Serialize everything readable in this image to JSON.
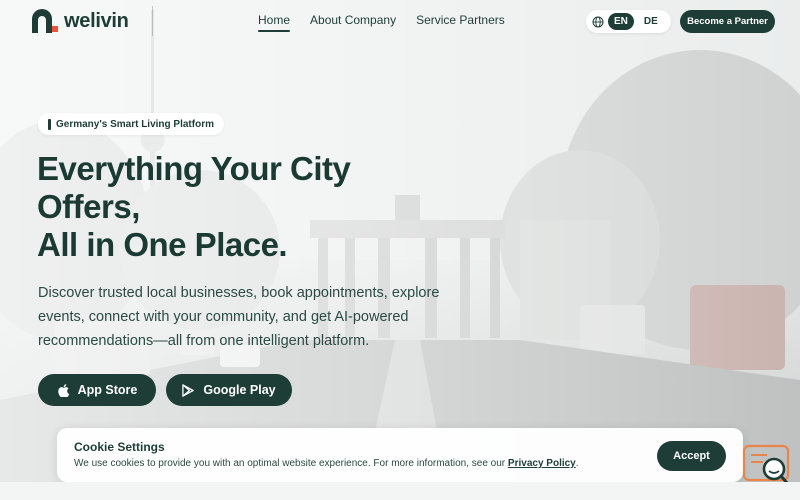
{
  "header": {
    "logo_text": "welivin",
    "nav": [
      {
        "label": "Home",
        "active": true
      },
      {
        "label": "About Company",
        "active": false
      },
      {
        "label": "Service Partners",
        "active": false
      }
    ],
    "languages": [
      {
        "code": "EN",
        "active": true
      },
      {
        "code": "DE",
        "active": false
      }
    ],
    "partner_button": "Become a Partner"
  },
  "hero": {
    "badge": "Germany's Smart Living Platform",
    "title_lines": [
      "Everything Your City",
      "Offers,",
      "All in One Place."
    ],
    "description": "Discover trusted local businesses, book appointments, explore events, connect with your community, and get AI-powered recommendations—all from one intelligent platform.",
    "app_store_label": "App Store",
    "google_play_label": "Google Play"
  },
  "cookie": {
    "title": "Cookie Settings",
    "text": "We use cookies to provide you with an optimal website experience. For more information, see our",
    "link": "Privacy Policy",
    "text_end": ".",
    "accept": "Accept"
  },
  "colors": {
    "brand": "#1d3d36",
    "logo_accent": "#e8543d"
  },
  "icons": {
    "language": "globe-icon",
    "app_store": "apple-icon",
    "google_play": "play-icon",
    "chat": "chat-search-icon"
  }
}
